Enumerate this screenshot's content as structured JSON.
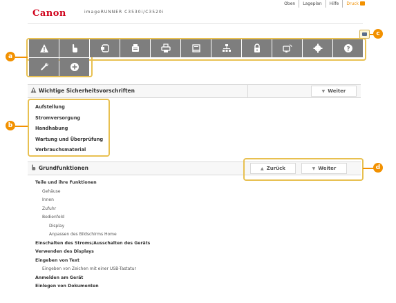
{
  "topnav": {
    "oben": "Oben",
    "lageplan": "Lageplan",
    "hilfe": "Hilfe",
    "druck": "Druck"
  },
  "header": {
    "logo": "Canon",
    "model": "imageRUNNER C3530i/C3520i"
  },
  "callouts": {
    "a": "a",
    "b": "b",
    "c": "c",
    "d": "d"
  },
  "toolbar": {
    "row1": [
      "warning-icon",
      "hand-icon",
      "copy-icon",
      "fax-icon",
      "printer-icon",
      "scanner-icon",
      "network-icon",
      "lock-icon",
      "remote-icon",
      "gear-icon",
      "help-icon"
    ],
    "row2": [
      "wrench-icon",
      "plus-icon"
    ]
  },
  "section1": {
    "title": "Wichtige Sicherheitsvorschriften",
    "weiter": "Weiter"
  },
  "section1_links": [
    "Aufstellung",
    "Stromversorgung",
    "Handhabung",
    "Wartung und Überprüfung",
    "Verbrauchsmaterial"
  ],
  "section2": {
    "title": "Grundfunktionen",
    "zurueck": "Zurück",
    "weiter": "Weiter"
  },
  "toc": [
    {
      "text": "Teile und ihre Funktionen",
      "level": 0
    },
    {
      "text": "Gehäuse",
      "level": 1
    },
    {
      "text": "Innen",
      "level": 1
    },
    {
      "text": "Zufuhr",
      "level": 1
    },
    {
      "text": "Bedienfeld",
      "level": 1
    },
    {
      "text": "Display",
      "level": 2
    },
    {
      "text": "Anpassen des Bildschirms Home",
      "level": 2
    },
    {
      "text": "Einschalten des Stroms/Ausschalten des Geräts",
      "level": 0
    },
    {
      "text": "Verwenden des Displays",
      "level": 0
    },
    {
      "text": "Eingeben von Text",
      "level": 0
    },
    {
      "text": "Eingeben von Zeichen mit einer USB-Tastatur",
      "level": 1
    },
    {
      "text": "Anmelden am Gerät",
      "level": 0
    },
    {
      "text": "Einlegen von Dokumenten",
      "level": 0
    }
  ],
  "colors": {
    "accent": "#f29100",
    "toolbar": "#7e7e7e",
    "highlight": "#e8c050",
    "brand": "#d0021b"
  }
}
